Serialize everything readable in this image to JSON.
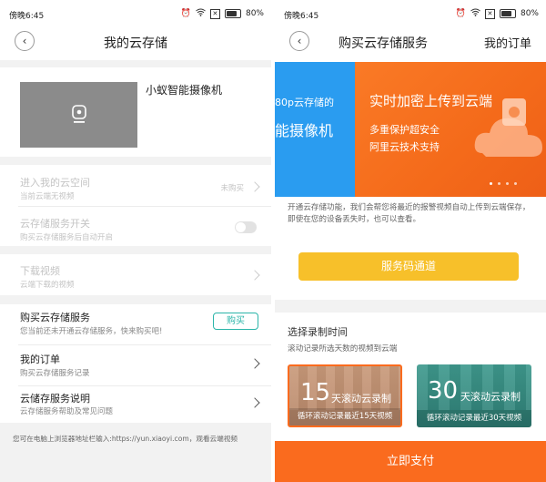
{
  "left": {
    "status": {
      "time": "傍晚6:45",
      "battery": "80%"
    },
    "title": "我的云存储",
    "device_name": "小蚁智能摄像机",
    "rows": {
      "enter_space": {
        "title": "进入我的云空间",
        "sub": "当前云端无视频",
        "right": "未购买"
      },
      "service_switch": {
        "title": "云存储服务开关",
        "sub": "购买云存储服务后自动开启"
      },
      "download": {
        "title": "下载视频",
        "sub": "云端下载的视频"
      },
      "buy": {
        "title": "购买云存储服务",
        "sub": "您当前还未开通云存储服务，快来购买吧!",
        "button": "购买"
      },
      "orders": {
        "title": "我的订单",
        "sub": "购买云存储服务记录"
      },
      "help": {
        "title": "云储存服务说明",
        "sub": "云存储服务帮助及常见问题"
      }
    },
    "footer": "您可在电脑上浏览器地址栏输入:https://yun.xiaoyi.com，观看云端视频"
  },
  "right": {
    "status": {
      "time": "傍晚6:45",
      "battery": "80%"
    },
    "title": "购买云存储服务",
    "title_right": "我的订单",
    "banner": {
      "left_line1": "80p云存储的",
      "left_line2": "能摄像机",
      "headline": "实时加密上传到云端",
      "sub1": "多重保护超安全",
      "sub2": "阿里云技术支持"
    },
    "description": "开通云存储功能，我们会帮您将最近的报警视频自动上传到云端保存，即使在您的设备丢失时，也可以查看。",
    "service_code_button": "服务码通道",
    "section_title": "选择录制时间",
    "section_sub": "滚动记录所选天数的视频到云端",
    "plans": [
      {
        "days": "15",
        "unit": "天滚动云录制",
        "caption": "循环滚动记录最近15天视频"
      },
      {
        "days": "30",
        "unit": "天滚动云录制",
        "caption": "循环滚动记录最近30天视频"
      }
    ],
    "pay_button": "立即支付"
  },
  "colors": {
    "accent_teal": "#2bb5a9",
    "yellow": "#f7c02a",
    "orange": "#fa6b1e",
    "blue": "#2a9cf0"
  }
}
